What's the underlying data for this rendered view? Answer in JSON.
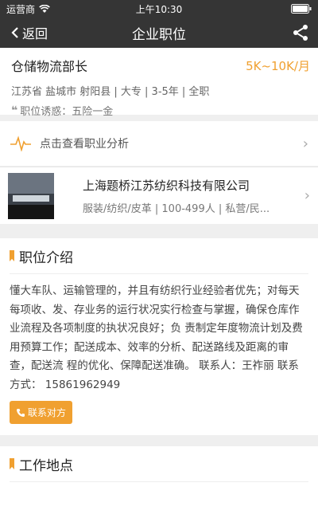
{
  "status": {
    "carrier": "运营商",
    "time": "上午10:30"
  },
  "nav": {
    "back_label": "返回",
    "title": "企业职位"
  },
  "job": {
    "title": "仓储物流部长",
    "salary": "5K~10K/月",
    "meta": "江苏省 盐城市 射阳县 | 大专 | 3-5年 | 全职",
    "perk": "职位诱惑：五险一金"
  },
  "analysis": {
    "label": "点击查看职业分析"
  },
  "company": {
    "name": "上海题桥江苏纺织科技有限公司",
    "meta": "服装/纺织/皮革 | 100-499人 | 私营/民..."
  },
  "description": {
    "heading": "职位介绍",
    "text": "懂大车队、运输管理的，并且有纺织行业经验者优先；对每天每项收、发、存业务的运行状况实行检查与掌握，确保仓库作业流程及各项制度的执状况良好；负 责制定年度物流计划及费用预算工作；配送成本、效率的分析、配送路线及距离的审查，配送流 程的优化、保障配送准确。 联系人：王祚丽 联系方式： 15861962949",
    "contact_button": "联系对方"
  },
  "location": {
    "heading": "工作地点"
  },
  "colors": {
    "accent": "#f0a030",
    "bar": "#353535"
  }
}
